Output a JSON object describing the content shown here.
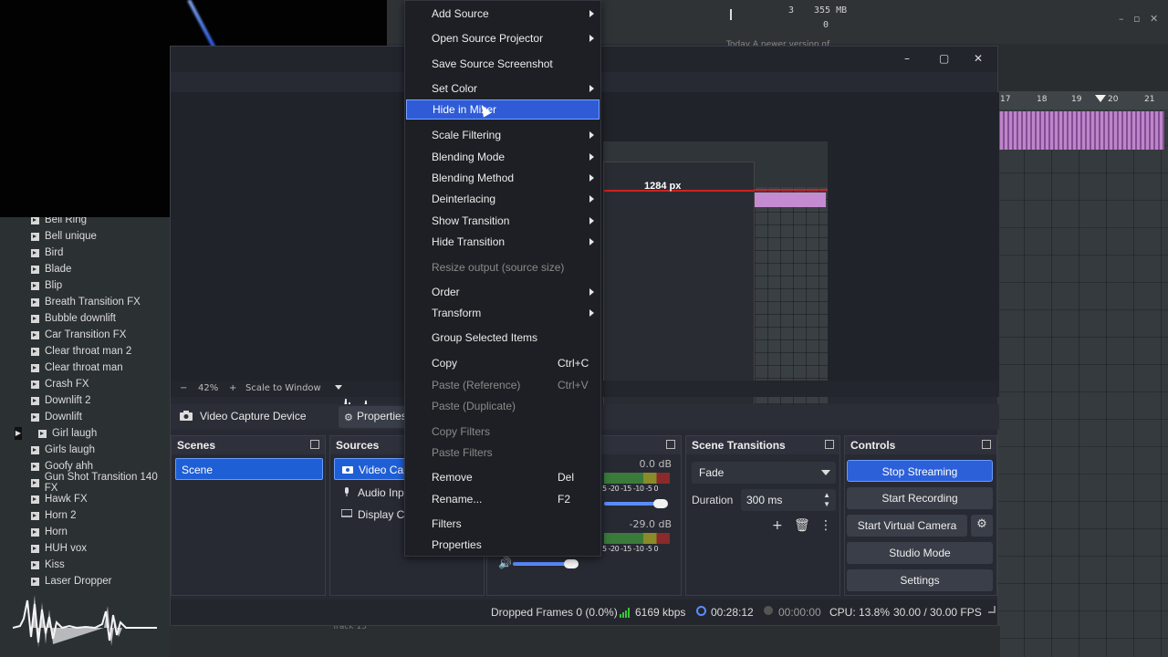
{
  "daw": {
    "meter_a": "3",
    "meter_mem": "355 MB",
    "meter_b": "0",
    "news": "Today  A newer version of",
    "ruler": [
      "17",
      "18",
      "19",
      "20",
      "21"
    ],
    "track_label": "Track 13",
    "browser_items": [
      "Bell Ring",
      "Bell unique",
      "Bird",
      "Blade",
      "Blip",
      "Breath Transition FX",
      "Bubble downlift",
      "Car Transition FX",
      "Clear throat man 2",
      "Clear throat man",
      "Crash FX",
      "Downlift 2",
      "Downlift",
      "Girl laugh",
      "Girls laugh",
      "Goofy ahh",
      "Gun Shot Transition 140 FX",
      "Hawk FX",
      "Horn 2",
      "Horn",
      "HUH vox",
      "Kiss",
      "Laser Dropper"
    ]
  },
  "obs": {
    "nested_width_label": "1284 px",
    "zoom": {
      "minus": "−",
      "value": "42%",
      "plus": "+",
      "mode": "Scale to Window"
    },
    "selected_source": "Video Capture Device",
    "properties_label": "Properties",
    "scenes": {
      "title": "Scenes",
      "items": [
        "Scene"
      ]
    },
    "sources": {
      "title": "Sources",
      "items": [
        "Video Capt",
        "Audio Inpu",
        "Display Cap"
      ]
    },
    "mixer": {
      "db1": "0.0 dB",
      "db2": "-29.0 dB",
      "scale": "5 -20 -15 -10 -5 0"
    },
    "transitions": {
      "title": "Scene Transitions",
      "selected": "Fade",
      "duration_label": "Duration",
      "duration_value": "300 ms"
    },
    "controls": {
      "title": "Controls",
      "stop_streaming": "Stop Streaming",
      "start_recording": "Start Recording",
      "start_virtual_camera": "Start Virtual Camera",
      "studio_mode": "Studio Mode",
      "settings": "Settings"
    },
    "status": {
      "dropped": "Dropped Frames 0 (0.0%)",
      "bitrate": "6169 kbps",
      "stream_time": "00:28:12",
      "rec_time": "00:00:00",
      "cpu": "CPU: 13.8%",
      "fps": "30.00 / 30.00 FPS"
    }
  },
  "menu": {
    "items": [
      {
        "label": "Add Source",
        "submenu": true
      },
      {
        "label": "Open Source Projector",
        "submenu": true
      },
      {
        "label": "Save Source Screenshot"
      },
      {
        "label": "Set Color",
        "submenu": true
      },
      {
        "label": "Hide in Mixer",
        "highlighted": true
      },
      {
        "label": "Scale Filtering",
        "submenu": true
      },
      {
        "label": "Blending Mode",
        "submenu": true
      },
      {
        "label": "Blending Method",
        "submenu": true
      },
      {
        "label": "Deinterlacing",
        "submenu": true
      },
      {
        "label": "Show Transition",
        "submenu": true
      },
      {
        "label": "Hide Transition",
        "submenu": true
      },
      {
        "label": "Resize output (source size)",
        "disabled": true
      },
      {
        "label": "Order",
        "submenu": true
      },
      {
        "label": "Transform",
        "submenu": true
      },
      {
        "label": "Group Selected Items"
      },
      {
        "label": "Copy",
        "shortcut": "Ctrl+C"
      },
      {
        "label": "Paste (Reference)",
        "shortcut": "Ctrl+V",
        "disabled": true
      },
      {
        "label": "Paste (Duplicate)",
        "disabled": true
      },
      {
        "label": "Copy Filters",
        "disabled": true
      },
      {
        "label": "Paste Filters",
        "disabled": true
      },
      {
        "label": "Remove",
        "shortcut": "Del"
      },
      {
        "label": "Rename...",
        "shortcut": "F2"
      },
      {
        "label": "Filters"
      },
      {
        "label": "Properties"
      }
    ]
  }
}
